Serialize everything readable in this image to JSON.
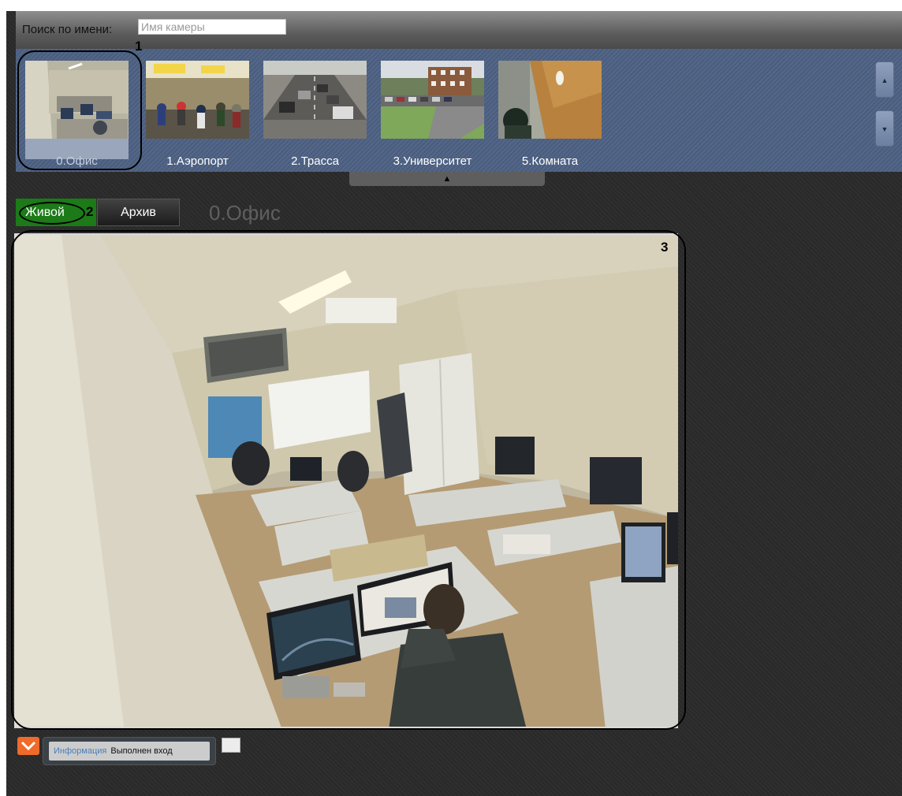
{
  "search": {
    "label": "Поиск по имени:",
    "placeholder": "Имя камеры"
  },
  "cameras": [
    {
      "label": "0.Офис",
      "selected": true
    },
    {
      "label": "1.Аэропорт",
      "selected": false
    },
    {
      "label": "2.Трасса",
      "selected": false
    },
    {
      "label": "3.Университет",
      "selected": false
    },
    {
      "label": "5.Комната",
      "selected": false
    }
  ],
  "strip_controls": {
    "up_icon": "▲",
    "down_icon": "▼",
    "collapse_icon": "▲"
  },
  "modes": {
    "live": "Живой",
    "archive": "Архив",
    "active": "live"
  },
  "current_camera": "0.Офис",
  "callouts": {
    "one": "1",
    "two": "2",
    "three": "3"
  },
  "status": {
    "key": "Информация",
    "value": "Выполнен вход"
  },
  "colors": {
    "strip_bg": "#4d6183",
    "live_active": "#1c7a18",
    "status_icon": "#f06a2a"
  }
}
